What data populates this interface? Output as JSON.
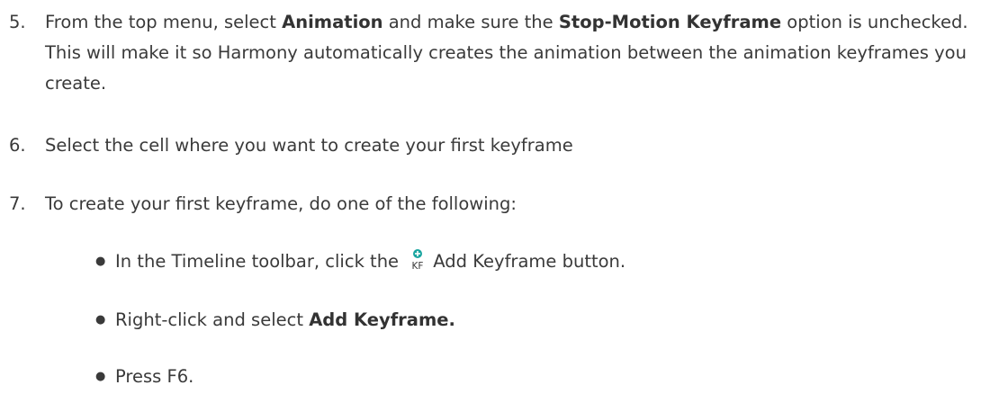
{
  "steps": [
    {
      "number": "5.",
      "t1": "From the top menu, select ",
      "b1": "Animation",
      "t2": " and make sure the ",
      "b2": "Stop-Motion Keyframe",
      "t3": " option is unchecked. This will make it so Harmony automatically creates the animation between the animation keyframes you create."
    },
    {
      "number": "6.",
      "text": "Select the cell where you want to create your first keyframe"
    },
    {
      "number": "7.",
      "text": "To create your first keyframe, do one of the following:",
      "bullets": [
        {
          "before": "In the Timeline toolbar, click the ",
          "icon": "add-keyframe-icon",
          "icon_label": "KF",
          "after": "Add Keyframe button."
        },
        {
          "before": "Right-click and select ",
          "bold": "Add Keyframe."
        },
        {
          "text": "Press F6."
        }
      ]
    }
  ],
  "colors": {
    "text": "#3a3a3a",
    "icon_accent": "#1aa5a0"
  }
}
